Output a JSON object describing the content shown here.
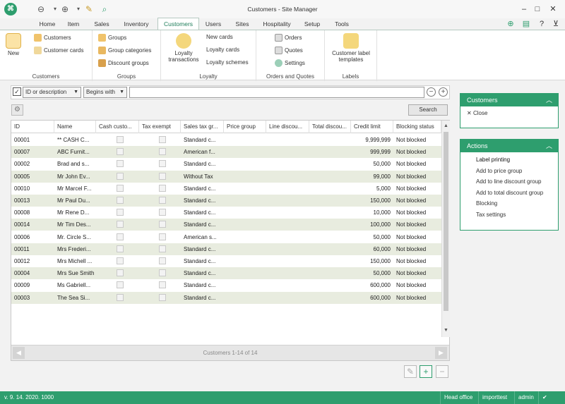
{
  "app": {
    "title": "Customers - Site Manager",
    "logo_icon": "app-logo-icon"
  },
  "quick_access": [
    "back-icon",
    "forward-icon",
    "notes-icon",
    "search-icon"
  ],
  "window_controls": {
    "minimize": "–",
    "maximize": "□",
    "close": "✕"
  },
  "tabs": [
    {
      "label": "Home"
    },
    {
      "label": "Item"
    },
    {
      "label": "Sales"
    },
    {
      "label": "Inventory"
    },
    {
      "label": "Customers"
    },
    {
      "label": "Users"
    },
    {
      "label": "Sites"
    },
    {
      "label": "Hospitality"
    },
    {
      "label": "Setup"
    },
    {
      "label": "Tools"
    }
  ],
  "active_tab": "Customers",
  "ribbon": {
    "customers": {
      "new": "New",
      "customers": "Customers",
      "customer_cards": "Customer cards",
      "label": "Customers"
    },
    "groups": {
      "groups": "Groups",
      "group_categories": "Group categories",
      "discount_groups": "Discount groups",
      "label": "Groups"
    },
    "loyalty": {
      "loyalty_transactions": "Loyalty transactions",
      "new_cards": "New cards",
      "loyalty_cards": "Loyalty cards",
      "loyalty_schemes": "Loyalty schemes",
      "label": "Loyalty"
    },
    "orders": {
      "orders": "Orders",
      "quotes": "Quotes",
      "settings": "Settings",
      "label": "Orders and Quotes"
    },
    "labels": {
      "customer_label_templates": "Customer label templates",
      "label": "Labels"
    }
  },
  "filter": {
    "field": "ID or description",
    "mode": "Begins with",
    "value": "",
    "search_label": "Search"
  },
  "grid": {
    "columns": [
      "ID",
      "Name",
      "Cash custo...",
      "Tax exempt",
      "Sales tax gr...",
      "Price group",
      "Line discou...",
      "Total discou...",
      "Credit limit",
      "Blocking status"
    ],
    "rows": [
      {
        "id": "00001",
        "name": "** CASH C...",
        "tax": "Standard c...",
        "credit": "9,999,999",
        "status": "Not blocked"
      },
      {
        "id": "00007",
        "name": "ABC Furnit...",
        "tax": "American f...",
        "credit": "999,999",
        "status": "Not blocked"
      },
      {
        "id": "00002",
        "name": "Brad and s...",
        "tax": "Standard c...",
        "credit": "50,000",
        "status": "Not blocked"
      },
      {
        "id": "00005",
        "name": "Mr John Ev...",
        "tax": "Without Tax",
        "credit": "99,000",
        "status": "Not blocked"
      },
      {
        "id": "00010",
        "name": "Mr Marcel F...",
        "tax": "Standard c...",
        "credit": "5,000",
        "status": "Not blocked"
      },
      {
        "id": "00013",
        "name": "Mr Paul Du...",
        "tax": "Standard c...",
        "credit": "150,000",
        "status": "Not blocked"
      },
      {
        "id": "00008",
        "name": "Mr Rene D...",
        "tax": "Standard c...",
        "credit": "10,000",
        "status": "Not blocked"
      },
      {
        "id": "00014",
        "name": "Mr Tim Des...",
        "tax": "Standard c...",
        "credit": "100,000",
        "status": "Not blocked"
      },
      {
        "id": "00006",
        "name": "Mr. Circle S...",
        "tax": "American s...",
        "credit": "50,000",
        "status": "Not blocked"
      },
      {
        "id": "00011",
        "name": "Mrs Frederi...",
        "tax": "Standard c...",
        "credit": "60,000",
        "status": "Not blocked"
      },
      {
        "id": "00012",
        "name": "Mrs Michell ...",
        "tax": "Standard c...",
        "credit": "150,000",
        "status": "Not blocked"
      },
      {
        "id": "00004",
        "name": "Mrs Sue Smith",
        "tax": "Standard c...",
        "credit": "50,000",
        "status": "Not blocked"
      },
      {
        "id": "00009",
        "name": "Ms Gabriell...",
        "tax": "Standard c...",
        "credit": "600,000",
        "status": "Not blocked"
      },
      {
        "id": "00003",
        "name": "The Sea Si...",
        "tax": "Standard c...",
        "credit": "600,000",
        "status": "Not blocked"
      }
    ],
    "footer": "Customers 1-14 of 14"
  },
  "side_panels": {
    "customers": {
      "title": "Customers",
      "items": [
        "Close"
      ]
    },
    "actions": {
      "title": "Actions",
      "items": [
        "Label printing",
        "Add to price group",
        "Add to line discount group",
        "Add to total discount group",
        "Blocking",
        "Tax settings"
      ]
    }
  },
  "statusbar": {
    "version": "v. 9. 14. 2020. 1000",
    "site": "Head office",
    "database": "importtest",
    "user": "admin"
  },
  "colors": {
    "accent": "#2e9e6e",
    "alt_row": "#e8ecdf"
  }
}
